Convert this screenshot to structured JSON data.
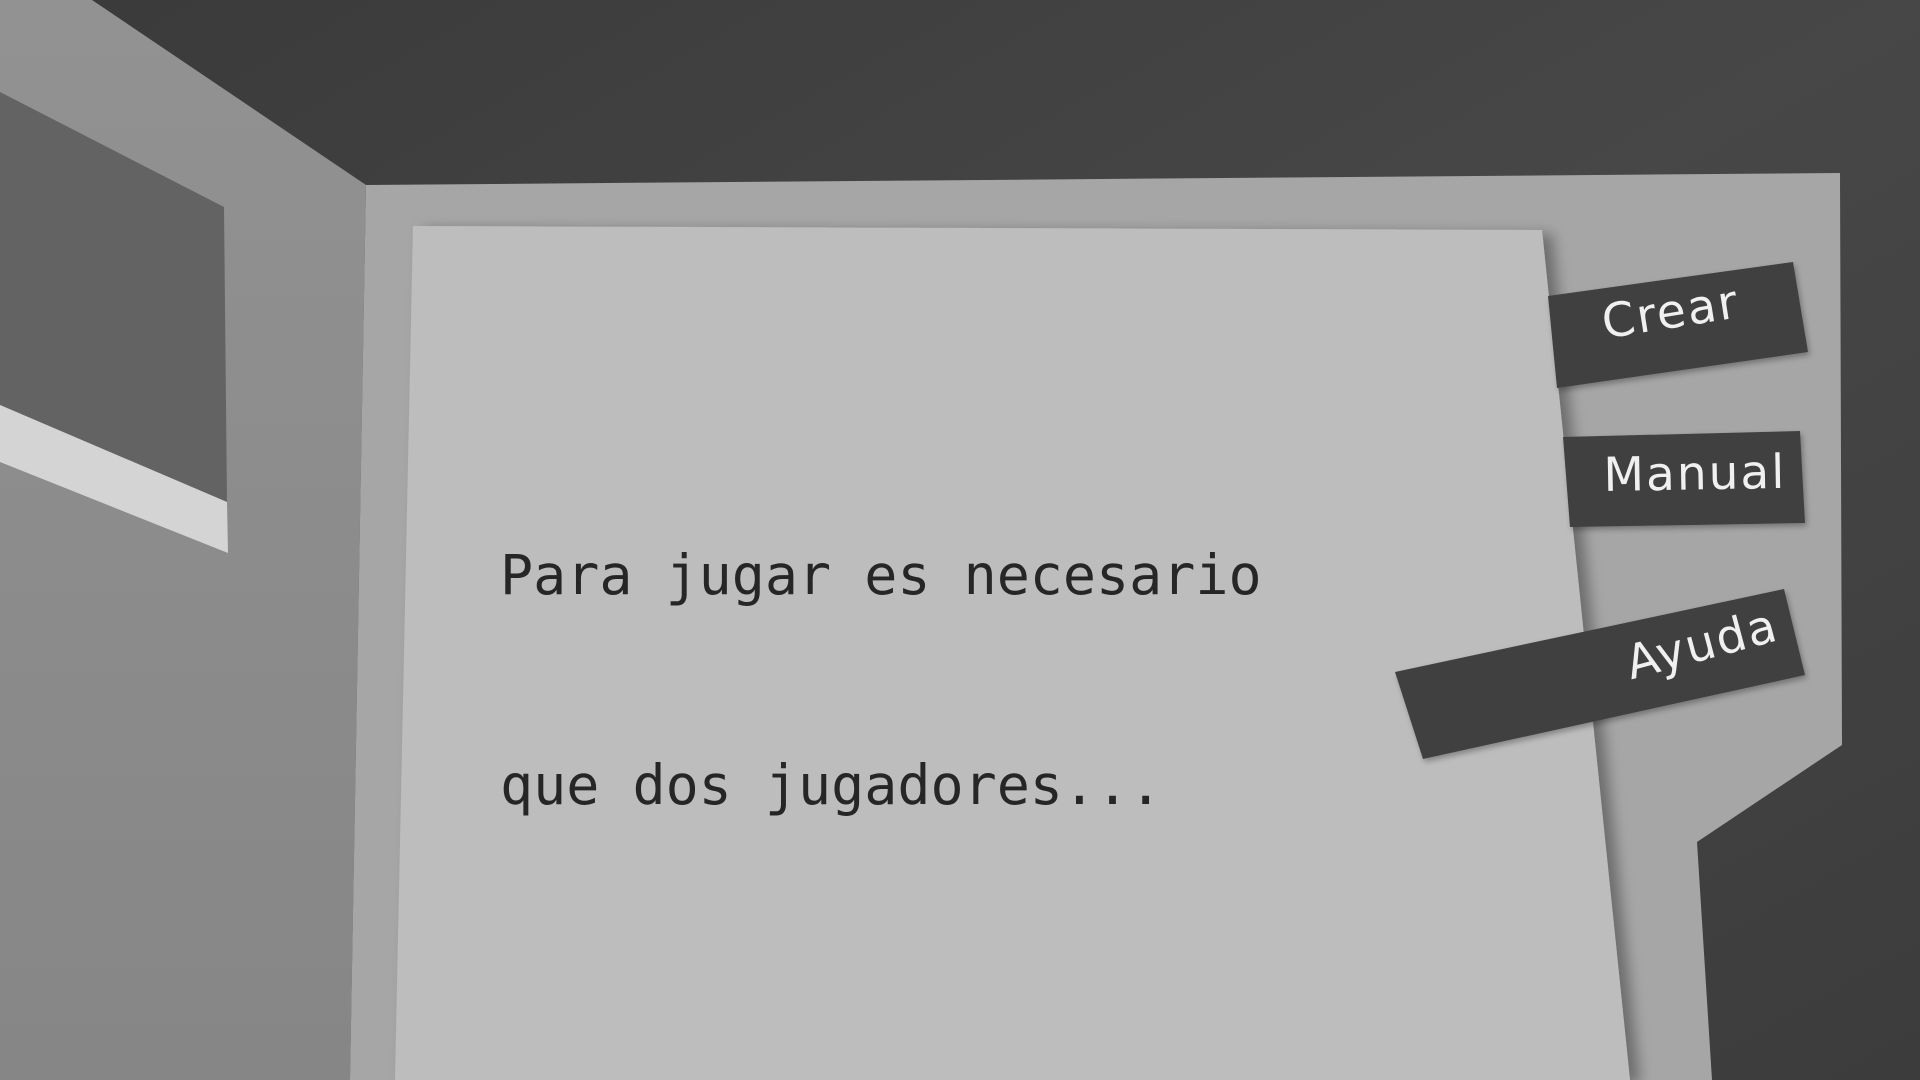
{
  "intro": {
    "line1": "Para jugar es necesario",
    "line2": "que dos jugadores..."
  },
  "tabs": {
    "crear": "Crear",
    "manual": "Manual",
    "ayuda": "Ayuda"
  },
  "colors": {
    "background": "#3f3f3f",
    "wall": "#8a8a8a",
    "window_frame": "#929292",
    "window_glass": "#626262",
    "window_sill": "#d4d4d4",
    "board": "#a6a6a6",
    "paper": "#bdbdbd",
    "tab": "#404040",
    "tab_text": "#f0f0f0",
    "text": "#262626"
  }
}
